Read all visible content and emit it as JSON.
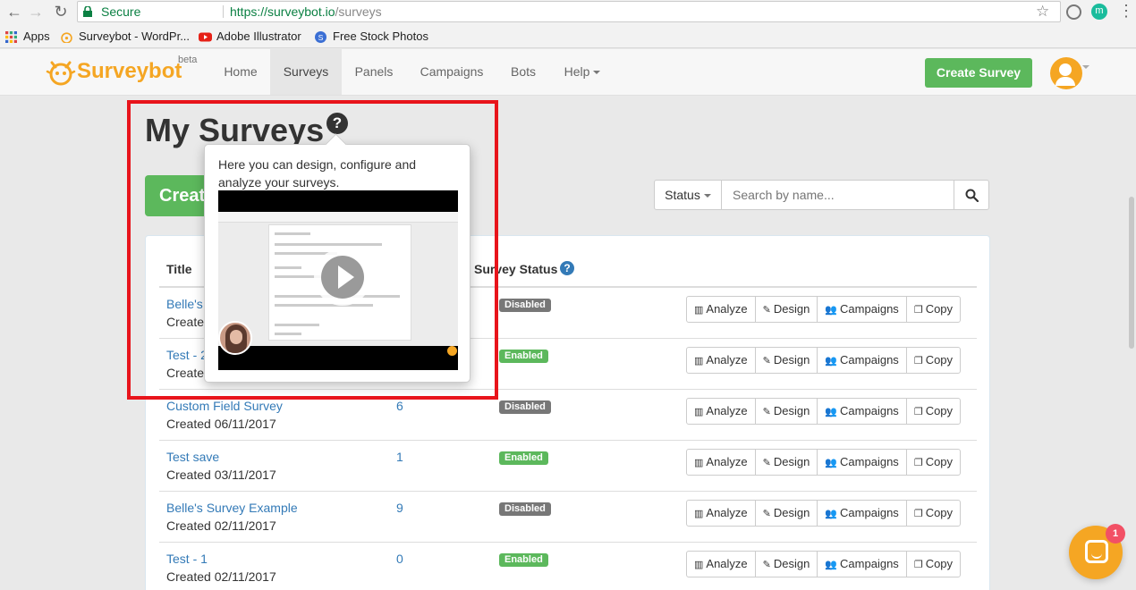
{
  "browser": {
    "secure_label": "Secure",
    "url_host": "https://surveybot.io",
    "url_path": "/surveys",
    "profile_initial": "m"
  },
  "bookmarks": [
    {
      "label": "Apps",
      "icon": "apps-grid-icon"
    },
    {
      "label": "Surveybot - WordPr...",
      "icon": "surveybot-icon"
    },
    {
      "label": "Adobe Illustrator",
      "icon": "youtube-icon"
    },
    {
      "label": "Free Stock Photos",
      "icon": "stock-photos-icon"
    }
  ],
  "navbar": {
    "brand": "Surveybot",
    "beta": "beta",
    "items": [
      {
        "label": "Home"
      },
      {
        "label": "Surveys",
        "active": true
      },
      {
        "label": "Panels"
      },
      {
        "label": "Campaigns"
      },
      {
        "label": "Bots"
      },
      {
        "label": "Help"
      }
    ],
    "create_label": "Create Survey"
  },
  "page": {
    "title": "My Surveys",
    "help_glyph": "?",
    "create_label_partial": "Create",
    "status_label": "Status",
    "search_placeholder": "Search by name..."
  },
  "table": {
    "headers": {
      "title": "Title",
      "status": "Survey Status"
    },
    "rows": [
      {
        "title": "Belle's",
        "created": "Created",
        "count": "",
        "status": "Disabled"
      },
      {
        "title": "Test - 2",
        "created": "Created",
        "count": "",
        "status": "Enabled"
      },
      {
        "title": "Custom Field Survey",
        "created": "Created 06/11/2017",
        "count": "6",
        "status": "Disabled"
      },
      {
        "title": "Test save",
        "created": "Created 03/11/2017",
        "count": "1",
        "status": "Enabled"
      },
      {
        "title": "Belle's Survey Example",
        "created": "Created 02/11/2017",
        "count": "9",
        "status": "Disabled"
      },
      {
        "title": "Test - 1",
        "created": "Created 02/11/2017",
        "count": "0",
        "status": "Enabled"
      }
    ],
    "actions": {
      "analyze": "Analyze",
      "design": "Design",
      "campaigns": "Campaigns",
      "copy": "Copy"
    }
  },
  "popover": {
    "text": "Here you can design, configure and analyze your surveys."
  },
  "chat": {
    "badge": "1"
  },
  "colors": {
    "brand": "#f5a623",
    "success": "#5cb85c",
    "link": "#337ab7",
    "highlight": "#e8141b"
  }
}
